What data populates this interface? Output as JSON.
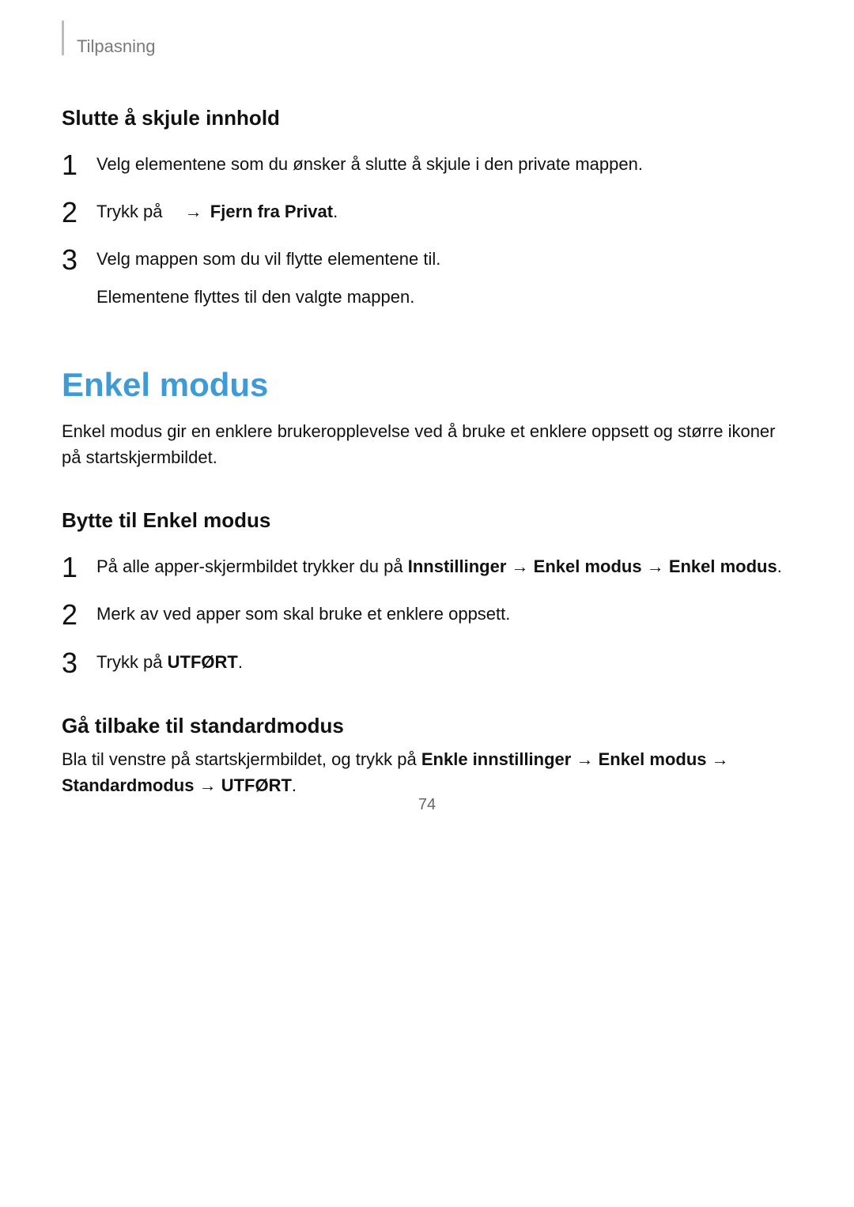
{
  "header_label": "Tilpasning",
  "section1_heading": "Slutte å skjule innhold",
  "section1_steps": {
    "s1": "Velg elementene som du ønsker å slutte å skjule i den private mappen.",
    "s2_pre": "Trykk på ",
    "s2_arrow": "→",
    "s2_bold": "Fjern fra Privat",
    "s2_period": ".",
    "s3_line1": "Velg mappen som du vil flytte elementene til.",
    "s3_line2": "Elementene flyttes til den valgte mappen."
  },
  "big_title": "Enkel modus",
  "intro": "Enkel modus gir en enklere brukeropplevelse ved å bruke et enklere oppsett og større ikoner på startskjermbildet.",
  "section2_heading": "Bytte til Enkel modus",
  "section2_steps": {
    "s1_pre": "På alle apper-skjermbildet trykker du på ",
    "s1_b1": "Innstillinger",
    "s1_a1": " → ",
    "s1_b2": "Enkel modus",
    "s1_a2": " → ",
    "s1_b3": "Enkel modus",
    "s1_period": ".",
    "s2": "Merk av ved apper som skal bruke et enklere oppsett.",
    "s3_pre": "Trykk på ",
    "s3_bold": "UTFØRT",
    "s3_period": "."
  },
  "section3_heading": "Gå tilbake til standardmodus",
  "section3": {
    "pre": "Bla til venstre på startskjermbildet, og trykk på ",
    "b1": "Enkle innstillinger",
    "a1": " → ",
    "b2": "Enkel modus",
    "a2": " → ",
    "b3": "Standardmodus",
    "a3": " → ",
    "b4": "UTFØRT",
    "period": "."
  },
  "page_number": "74"
}
